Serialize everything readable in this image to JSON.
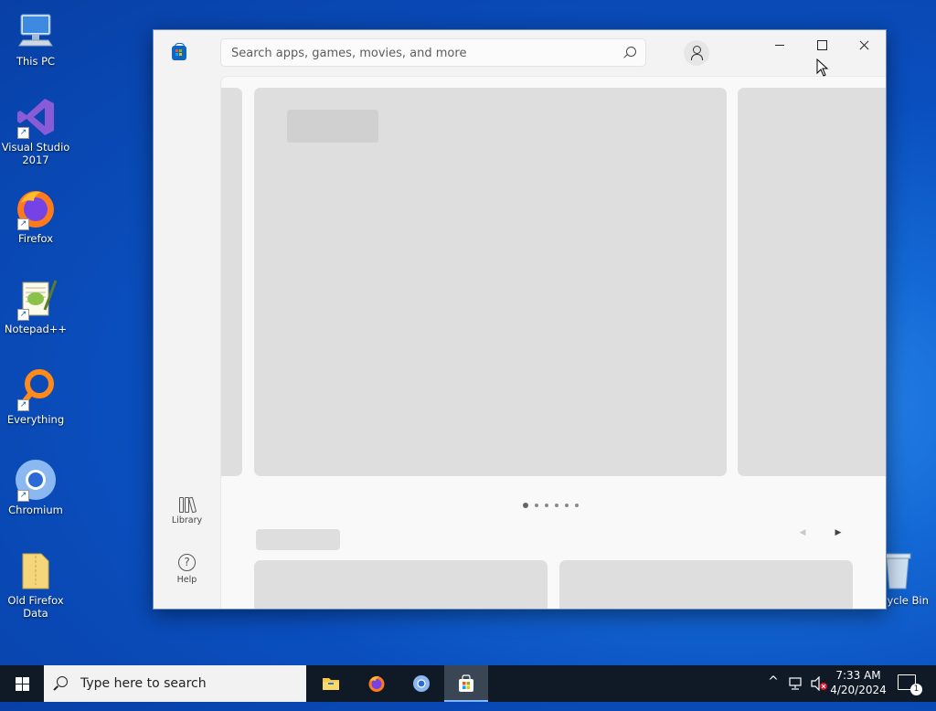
{
  "desktop": {
    "icons": [
      {
        "label": "This PC"
      },
      {
        "label": "Visual Studio 2017"
      },
      {
        "label": "Firefox"
      },
      {
        "label": "Notepad++"
      },
      {
        "label": "Everything"
      },
      {
        "label": "Chromium"
      },
      {
        "label": "Old Firefox Data"
      },
      {
        "label": "cycle Bin"
      }
    ]
  },
  "store": {
    "search_placeholder": "Search apps, games, movies, and more",
    "search_value": "",
    "nav": {
      "library_label": "Library",
      "help_label": "Help",
      "help_glyph": "?"
    },
    "carousel": {
      "dot_count": 6,
      "active_dot": 0
    },
    "section_prev_arrow": "◀",
    "section_next_arrow": "▶",
    "accent_color": "#0e66c4"
  },
  "taskbar": {
    "search_placeholder": "Type here to search",
    "pinned_apps": [
      "File Explorer",
      "Firefox",
      "Chromium",
      "Microsoft Store"
    ],
    "active_app": "Microsoft Store",
    "time": "7:33 AM",
    "date": "4/20/2024",
    "notification_count": "1",
    "show_hidden_icons_glyph": "^"
  }
}
